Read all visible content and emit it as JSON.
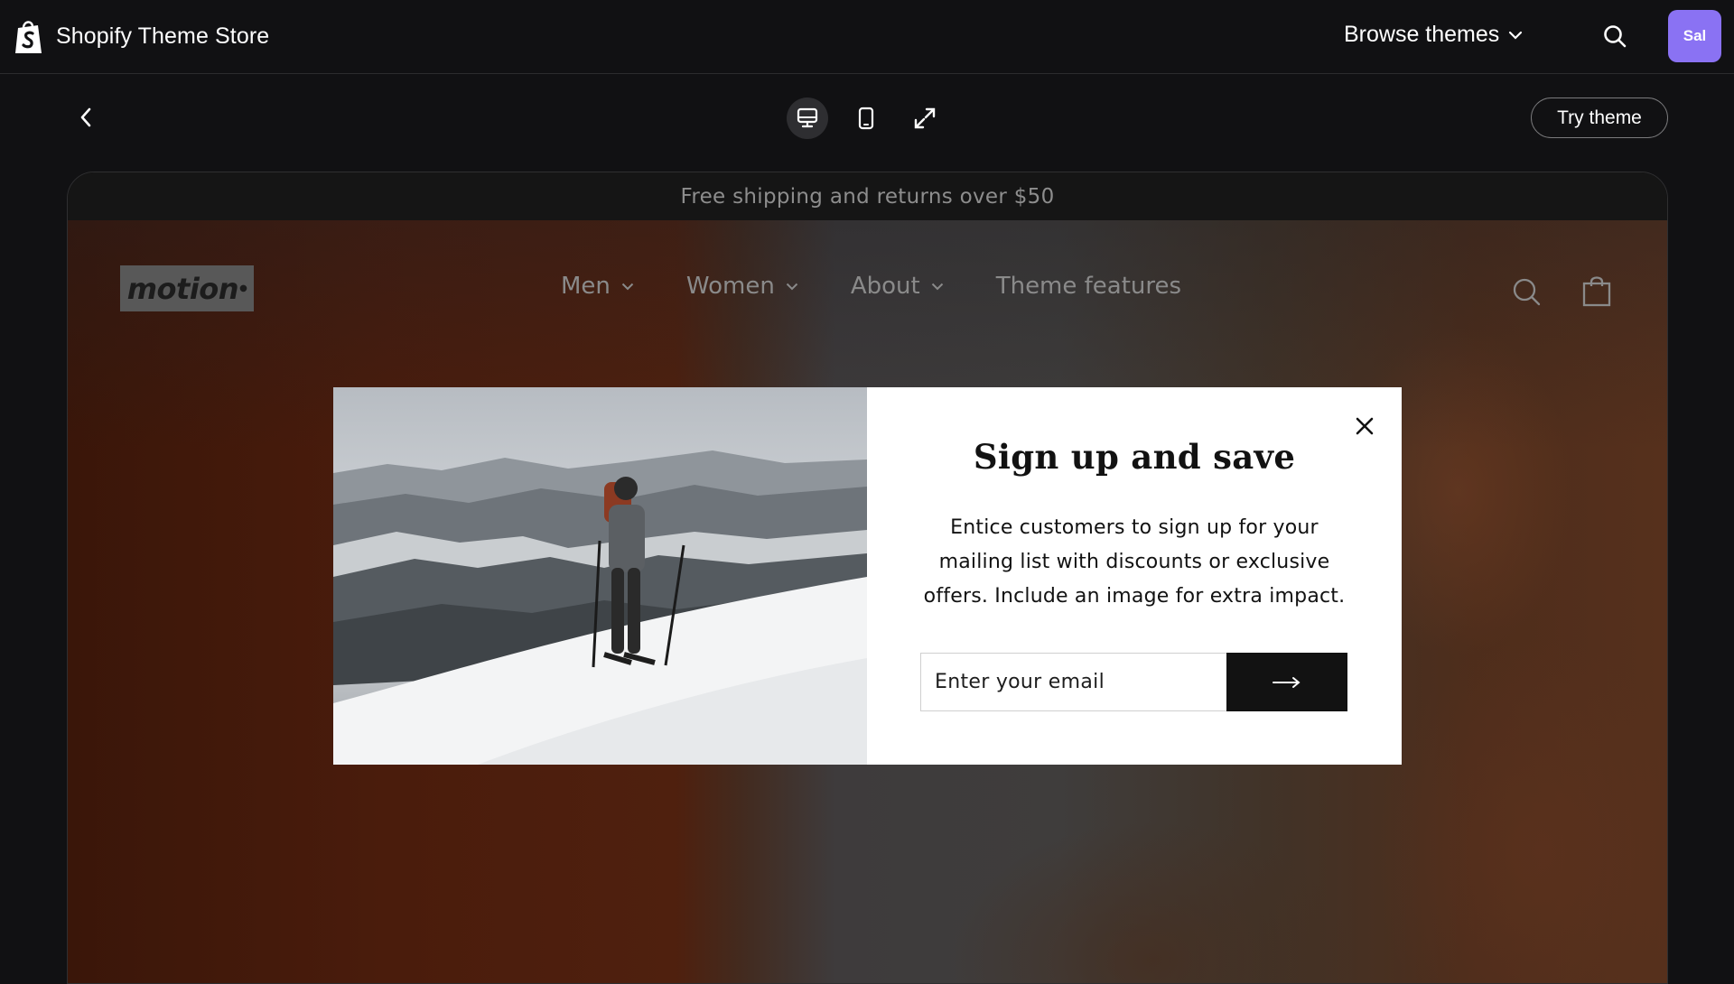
{
  "store_bar": {
    "title": "Shopify Theme Store",
    "browse_label": "Browse themes",
    "avatar_initials": "Sal",
    "avatar_color": "#8a72f3"
  },
  "toolbar": {
    "devices": [
      "desktop-icon",
      "mobile-icon",
      "expand-icon"
    ],
    "active_device": "desktop",
    "try_label": "Try theme"
  },
  "preview": {
    "announcement": "Free shipping and returns over $50",
    "logo_text": "motion",
    "nav": [
      {
        "label": "Men",
        "has_dropdown": true
      },
      {
        "label": "Women",
        "has_dropdown": true
      },
      {
        "label": "About",
        "has_dropdown": true
      },
      {
        "label": "Theme features",
        "has_dropdown": false
      }
    ],
    "icons": [
      "search-icon",
      "shopping-bag-icon"
    ]
  },
  "popup": {
    "title": "Sign up and save",
    "text": "Entice customers to sign up for your mailing list with discounts or exclusive offers. Include an image for extra impact.",
    "email_placeholder": "Enter your email",
    "submit_icon": "arrow-right-icon",
    "close_icon": "close-icon"
  }
}
